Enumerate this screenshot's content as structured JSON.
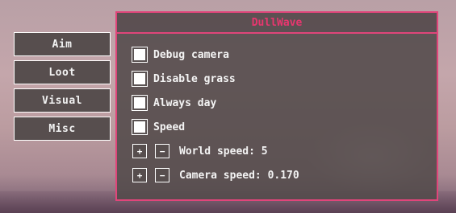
{
  "sidebar": {
    "items": [
      {
        "label": "Aim"
      },
      {
        "label": "Loot"
      },
      {
        "label": "Visual"
      },
      {
        "label": "Misc"
      }
    ]
  },
  "panel": {
    "title": "DullWave",
    "checkboxes": [
      {
        "label": "Debug camera",
        "checked": false
      },
      {
        "label": "Disable grass",
        "checked": false
      },
      {
        "label": "Always day",
        "checked": false
      },
      {
        "label": "Speed",
        "checked": false
      }
    ],
    "steppers": [
      {
        "plus": "+",
        "minus": "−",
        "label": "World speed: 5"
      },
      {
        "plus": "+",
        "minus": "−",
        "label": "Camera speed: 0.170"
      }
    ]
  },
  "colors": {
    "accent": "#e0457a",
    "title": "#e8366f",
    "button_bg": "#574e4e"
  }
}
